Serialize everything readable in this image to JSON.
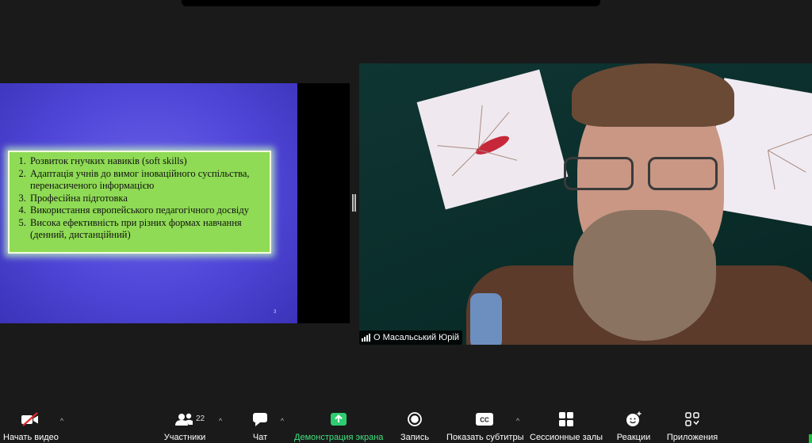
{
  "slide": {
    "items": [
      "Розвиток гнучких навиків (soft skills)",
      "Адаптація учнів до вимог іноваційного суспільства, перенасиченого інформацією",
      "Професійна підготовка",
      "Використання європейського педагогічного досвіду",
      "Висока ефективність при різних формах навчання (денний, дистанційний)"
    ],
    "page_number": "3"
  },
  "participant": {
    "name": "О Масальський Юрій"
  },
  "toolbar": {
    "video_label": "Начать видео",
    "participants_label": "Участники",
    "participants_count": "22",
    "chat_label": "Чат",
    "share_label": "Демонстрация экрана",
    "record_label": "Запись",
    "captions_label": "Показать субтитры",
    "breakout_label": "Сессионные залы",
    "reactions_label": "Реакции",
    "apps_label": "Приложения"
  },
  "colors": {
    "share_green": "#3fe27e",
    "slide_background": "#5048da",
    "slide_box": "#8fdb55"
  },
  "icons": {
    "video": "video-off-icon",
    "participants": "participants-icon",
    "chat": "chat-bubble-icon",
    "share": "share-screen-arrow-icon",
    "record": "record-icon",
    "captions": "cc-icon",
    "breakout": "grid-icon",
    "reactions": "smiley-icon",
    "apps": "apps-icon"
  }
}
